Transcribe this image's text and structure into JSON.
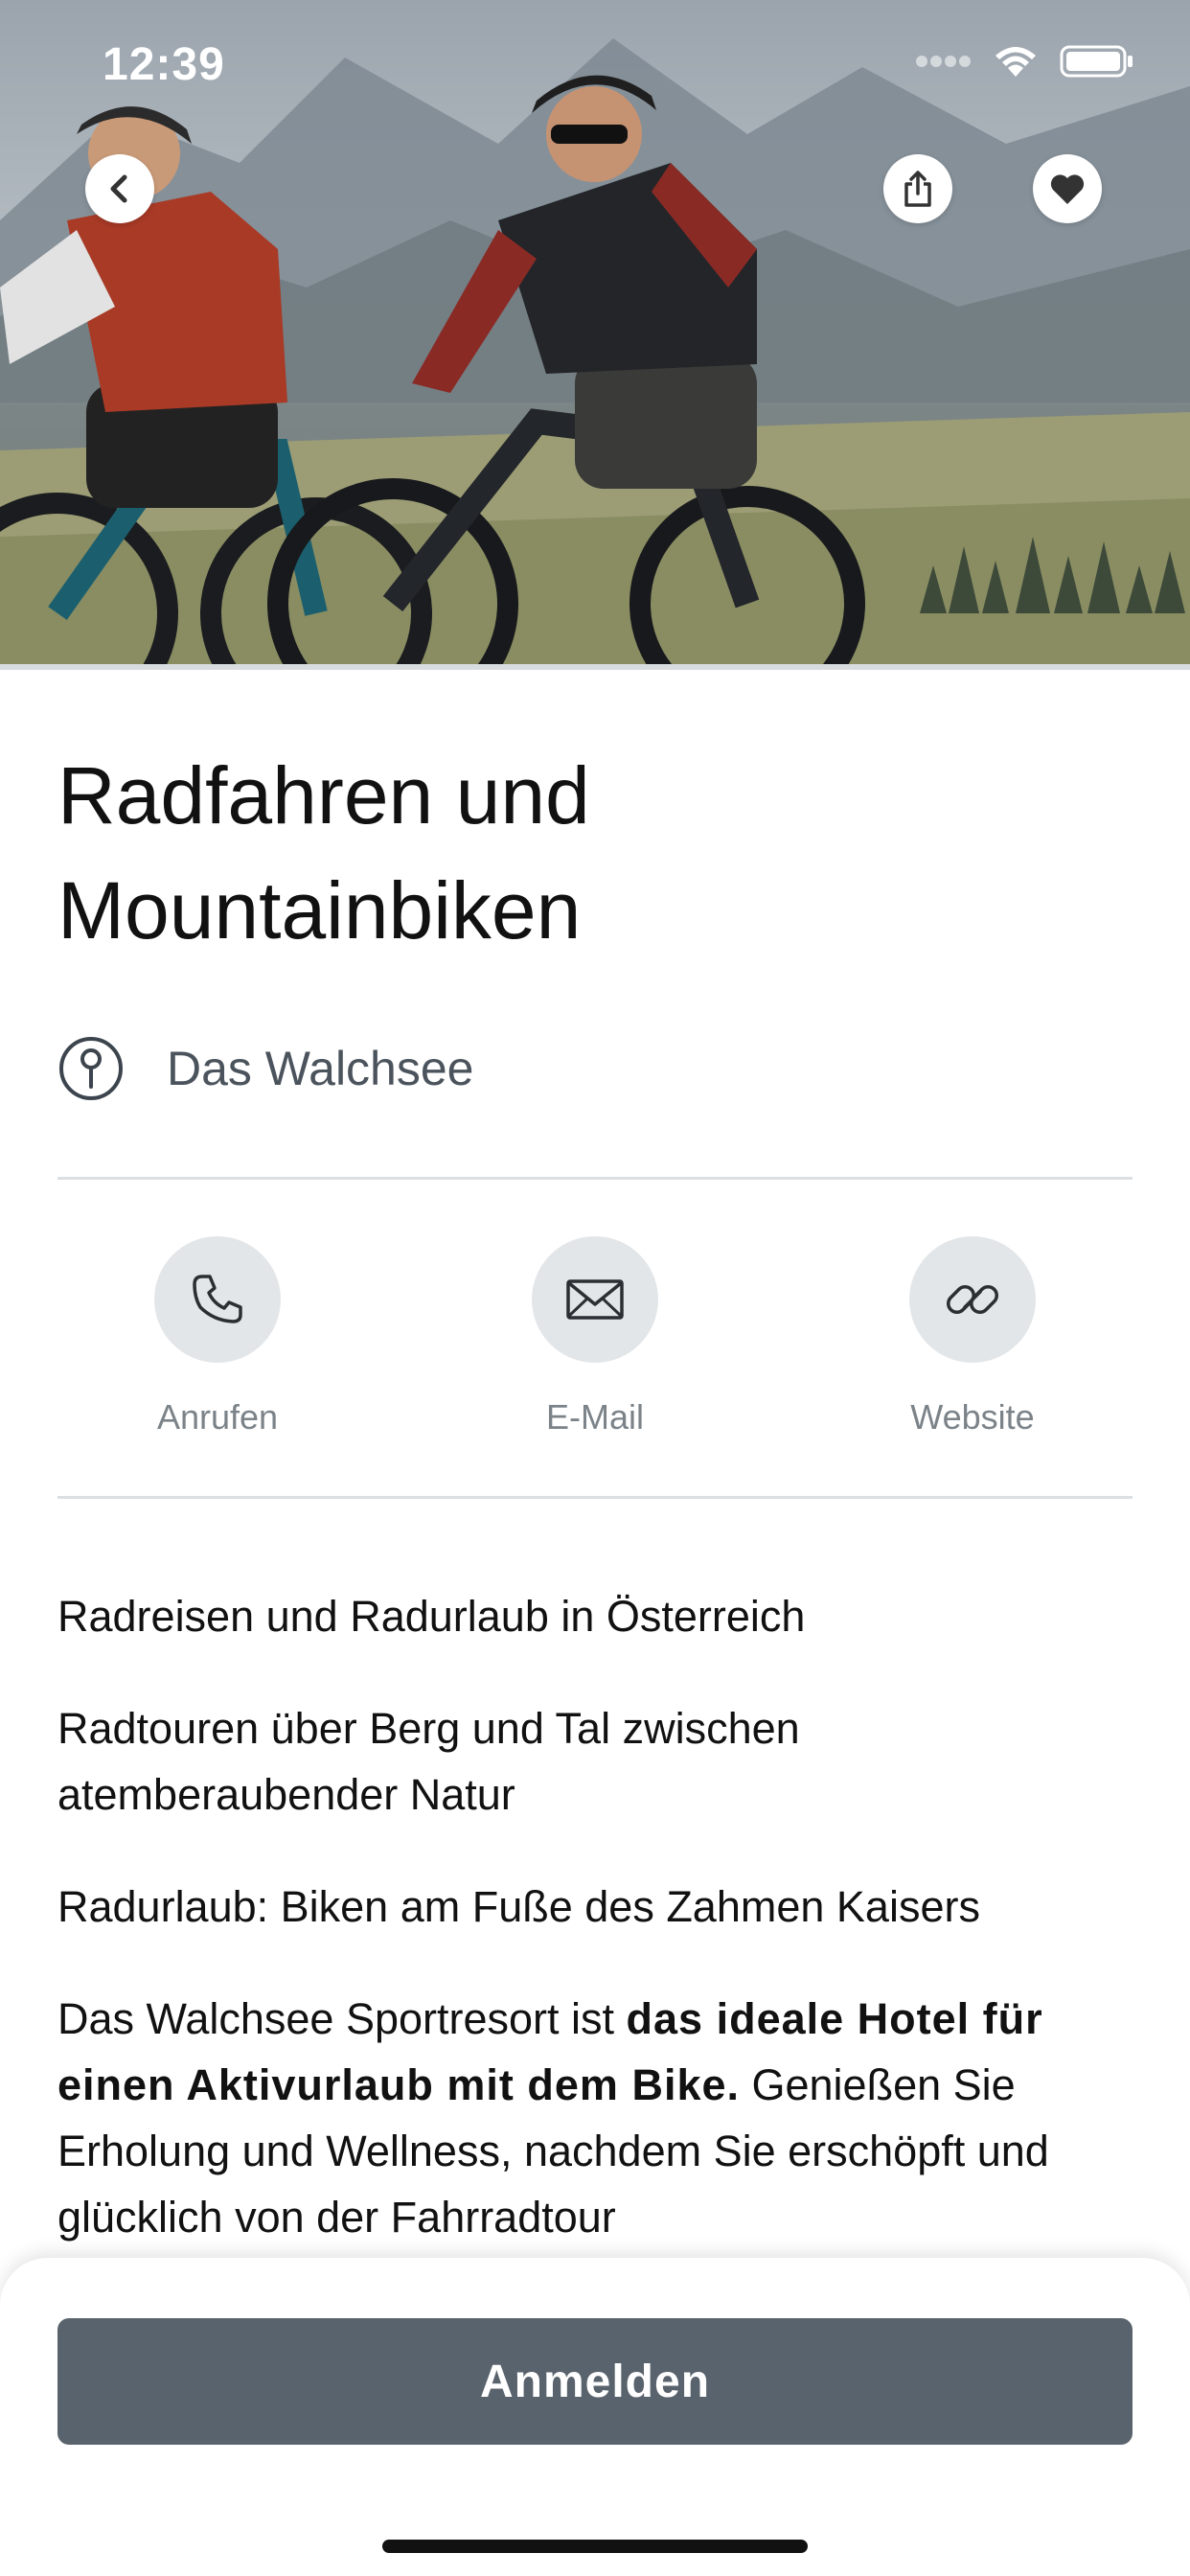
{
  "status_bar": {
    "time": "12:39"
  },
  "hero": {
    "image_alt": "Two mountain bikers riding e-bikes in front of a mountain landscape"
  },
  "activity": {
    "title_line1": "Radfahren und",
    "title_line2": "Mountainbiken",
    "location": "Das Walchsee"
  },
  "actions": [
    {
      "label": "Anrufen",
      "icon": "phone-icon"
    },
    {
      "label": "E-Mail",
      "icon": "mail-icon"
    },
    {
      "label": "Website",
      "icon": "link-icon"
    }
  ],
  "description": {
    "p1": "Radreisen und Radurlaub in Österreich",
    "p2": "Radtouren über Berg und Tal zwischen atemberaubender Natur",
    "p3": "Radurlaub: Biken am Fuße des Zahmen Kaisers",
    "p4_start": "Das Walchsee Sportresort ist ",
    "p4_bold": "das ideale Hotel für einen Aktivurlaub mit dem Bike.",
    "p4_end": " Genießen Sie Erholung und Wellness, nachdem Sie erschöpft und glücklich von der Fahrradtour"
  },
  "cta": {
    "label": "Anmelden"
  },
  "colors": {
    "cta_background": "#59636d",
    "action_circle": "#e3e6e8",
    "action_label": "#7b8389",
    "divider": "#dcdfe2"
  }
}
